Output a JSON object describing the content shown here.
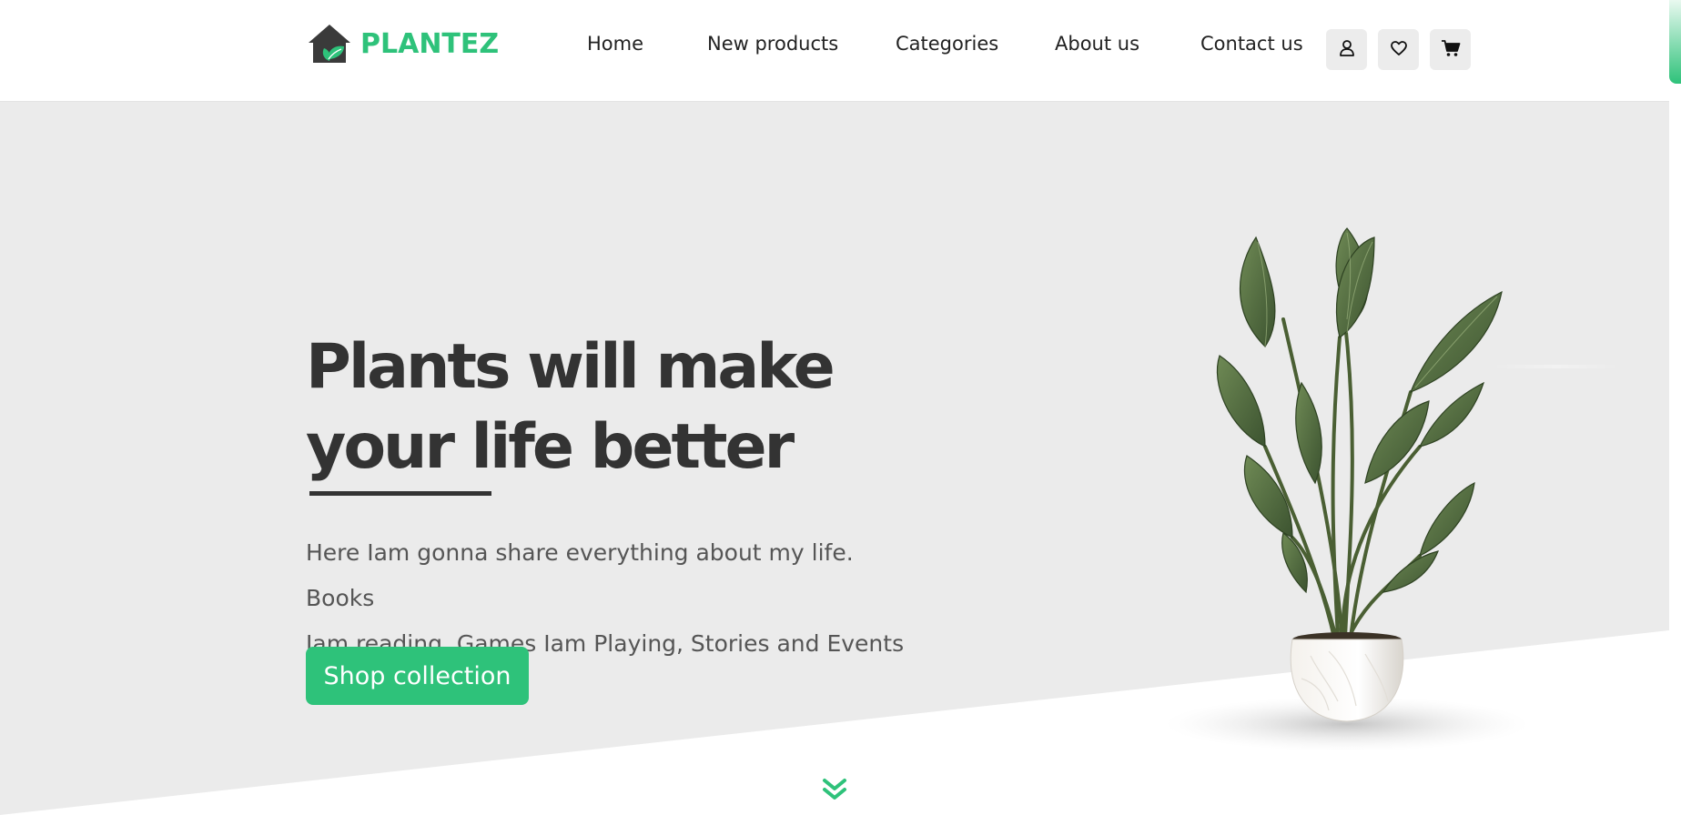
{
  "brand": {
    "name": "PLANTEZ",
    "logo_icon": "house-leaf-icon",
    "accent_color": "#2ec27a"
  },
  "nav": {
    "items": [
      {
        "label": "Home"
      },
      {
        "label": "New products"
      },
      {
        "label": "Categories"
      },
      {
        "label": "About us"
      },
      {
        "label": "Contact us"
      }
    ],
    "icons": [
      "user-icon",
      "heart-icon",
      "cart-icon"
    ]
  },
  "hero": {
    "title_line1": "Plants will make",
    "title_line2": "your life better",
    "description_line1": "Here Iam gonna share everything about my life. Books",
    "description_line2": "Iam reading, Games Iam Playing, Stories and Events",
    "cta_label": "Shop collection",
    "image": "potted-plant-image"
  },
  "scroll_indicator": "double-chevron-down-icon"
}
